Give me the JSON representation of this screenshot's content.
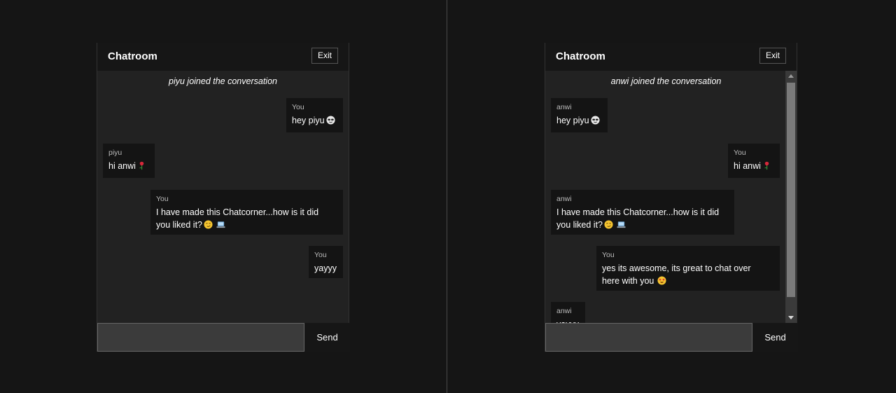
{
  "left": {
    "title": "Chatroom",
    "exit_label": "Exit",
    "system": "piyu joined the conversation",
    "messages": [
      {
        "who": "You",
        "text": "hey piyu",
        "emoji": "smiling-face-with-sunglasses-icon"
      },
      {
        "who": "piyu",
        "text": "hi anwi",
        "emoji": "rose-icon"
      },
      {
        "who": "You",
        "text_line1": "I have made this Chatcorner...how is it did",
        "text_line2": "you liked it?",
        "emoji": "smirk-and-laptop-icons"
      },
      {
        "who": "You",
        "text": "yayyy"
      }
    ],
    "input_value": "",
    "send_label": "Send"
  },
  "right": {
    "title": "Chatroom",
    "exit_label": "Exit",
    "system": "anwi joined the conversation",
    "messages": [
      {
        "who": "anwi",
        "text": "hey piyu",
        "emoji": "smiling-face-with-sunglasses-icon"
      },
      {
        "who": "You",
        "text": "hi anwi",
        "emoji": "rose-icon"
      },
      {
        "who": "anwi",
        "text_line1": "I have made this Chatcorner...how is it did",
        "text_line2": "you liked it?",
        "emoji": "smirk-and-laptop-icons"
      },
      {
        "who": "You",
        "text_line1": "yes its awesome, its great to chat over",
        "text_line2": "here with you",
        "emoji": "star-struck-icon"
      },
      {
        "who": "anwi",
        "text": "yayyy"
      }
    ],
    "input_value": "",
    "send_label": "Send"
  },
  "colors": {
    "page_bg": "#151515",
    "chat_bg": "#222222",
    "bubble_bg": "#141414",
    "input_bg": "#3b3b3b"
  }
}
